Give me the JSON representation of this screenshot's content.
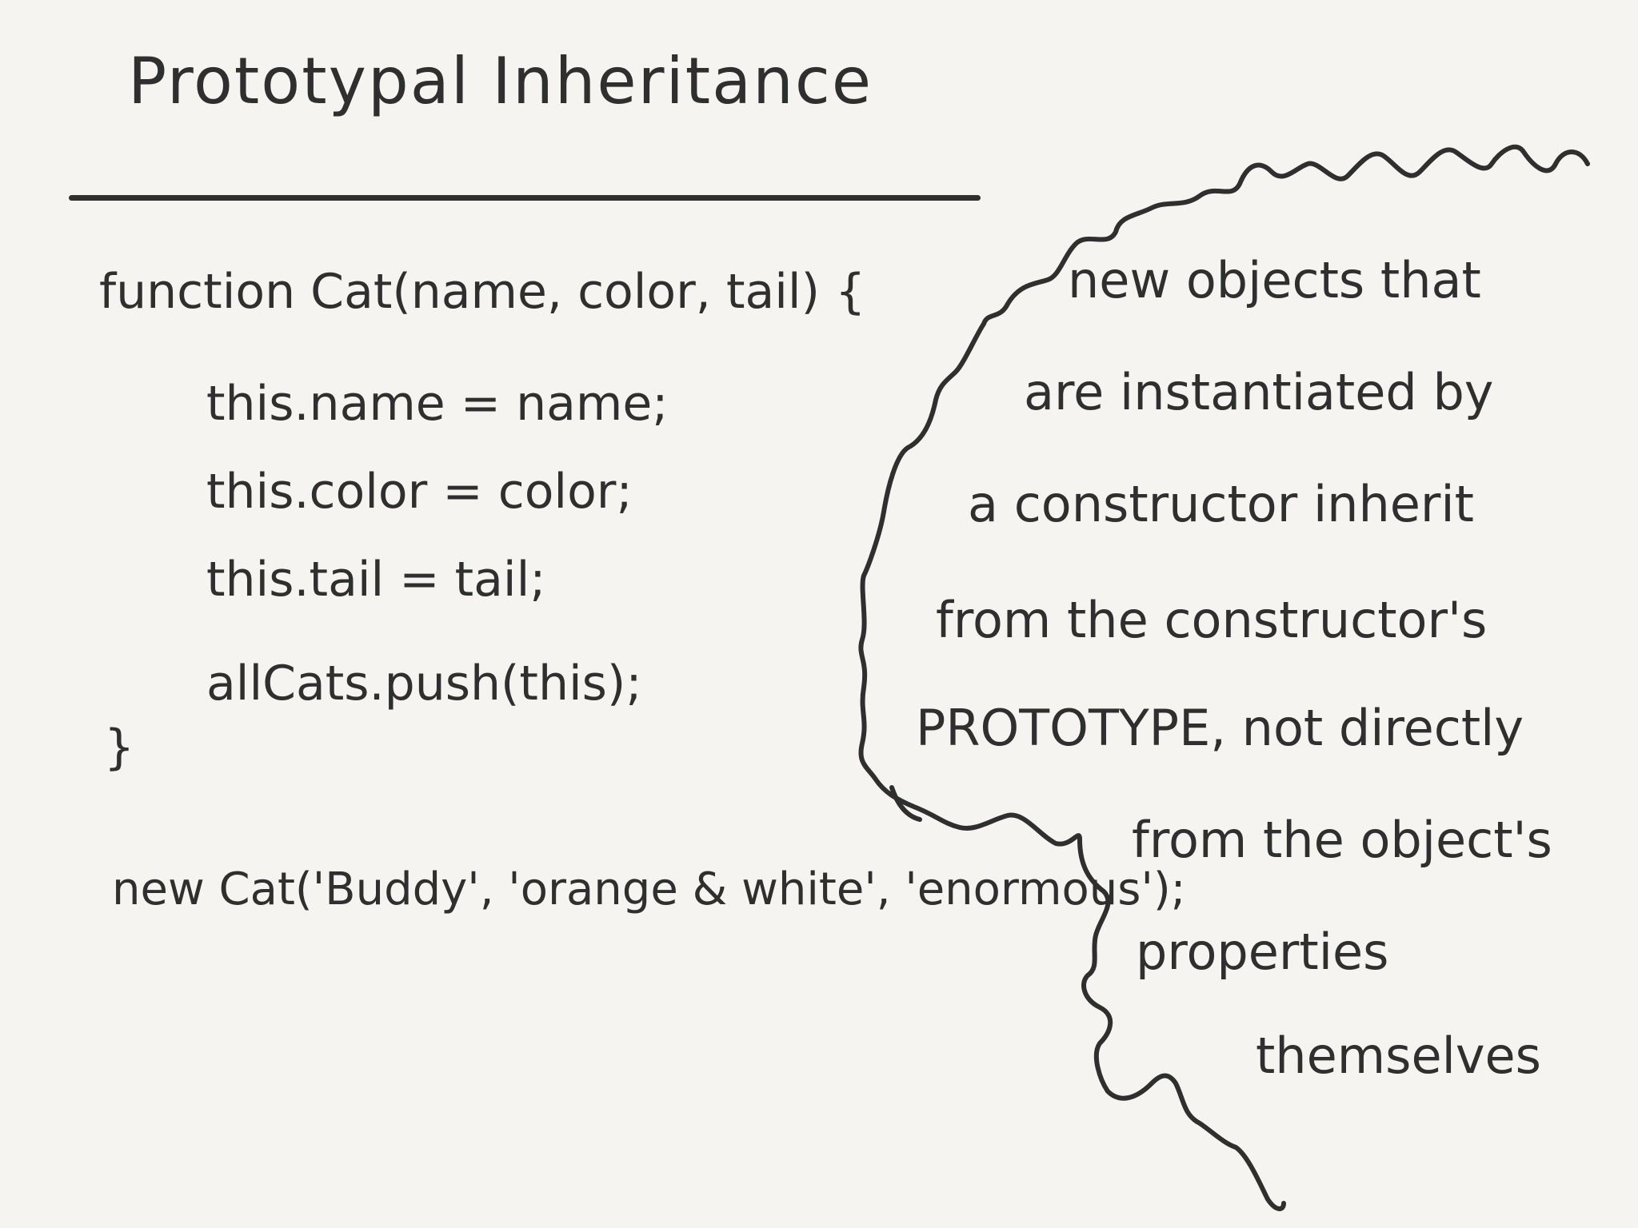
{
  "title": "Prototypal Inheritance",
  "code": {
    "lines": [
      "function Cat(name, color, tail) {",
      "this.name = name;",
      "this.color = color;",
      "this.tail = tail;",
      "allCats.push(this);",
      "}",
      "new Cat('Buddy', 'orange & white', 'enormous');"
    ]
  },
  "bubble": {
    "lines": [
      "new objects that",
      "are instantiated by",
      "a constructor inherit",
      "from the constructor's",
      "PROTOTYPE, not directly",
      "from the object's",
      "properties",
      "themselves"
    ]
  },
  "colors": {
    "ink": "#2f2f2f",
    "paper": "#f5f4f0"
  }
}
